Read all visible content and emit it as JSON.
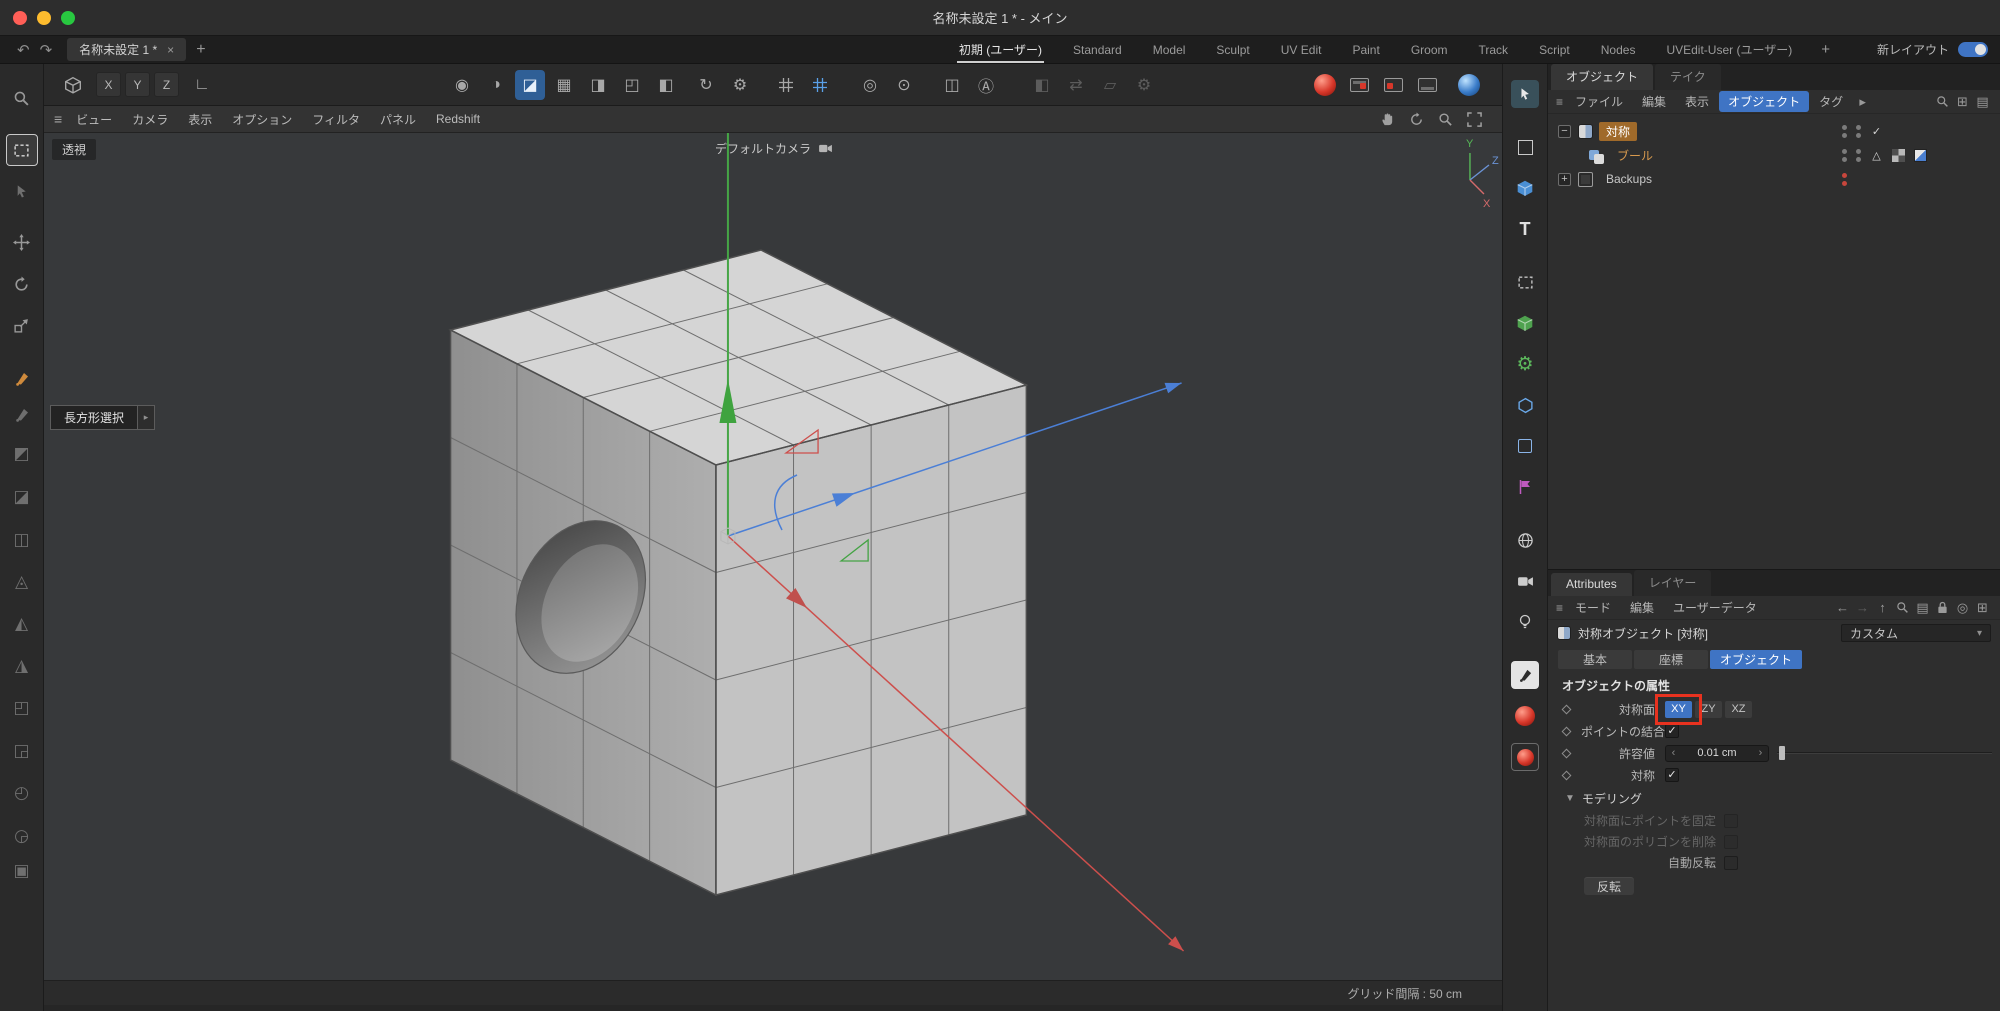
{
  "window": {
    "title": "名称未設定 1 * - メイン"
  },
  "tabbar": {
    "document_tab": "名称未設定 1 *",
    "layout_tabs": [
      "初期 (ユーザー)",
      "Standard",
      "Model",
      "Sculpt",
      "UV Edit",
      "Paint",
      "Groom",
      "Track",
      "Script",
      "Nodes",
      "UVEdit-User (ユーザー)"
    ],
    "active_layout_tab": "初期 (ユーザー)",
    "new_layout_label": "新レイアウト"
  },
  "toolbar": {
    "axis_lock": [
      "X",
      "Y",
      "Z"
    ]
  },
  "viewport": {
    "menu": [
      "ビュー",
      "カメラ",
      "表示",
      "オプション",
      "フィルタ",
      "パネル",
      "Redshift"
    ],
    "projection_label": "透視",
    "camera_label": "デフォルトカメラ",
    "tool_hint": "長方形選択",
    "grid_status": "グリッド間隔 : 50 cm",
    "axis_indicator": {
      "x": "X",
      "y": "Y",
      "z": "Z"
    }
  },
  "object_manager": {
    "tabs": [
      "オブジェクト",
      "テイク"
    ],
    "menu": [
      "ファイル",
      "編集",
      "表示",
      "オブジェクト",
      "タグ"
    ],
    "highlighted_menu_item": "オブジェクト",
    "objects": [
      {
        "name": "対称",
        "selected": true
      },
      {
        "name": "ブール",
        "child_of": "対称"
      },
      {
        "name": "Backups",
        "selected": false
      }
    ]
  },
  "attributes": {
    "tabs": [
      "Attributes",
      "レイヤー"
    ],
    "menu": [
      "モード",
      "編集",
      "ユーザーデータ"
    ],
    "object_title": "対称オブジェクト [対称]",
    "preset_value": "カスタム",
    "section_tabs": [
      "基本",
      "座標",
      "オブジェクト"
    ],
    "active_section_tab": "オブジェクト",
    "group_title": "オブジェクトの属性",
    "mirror_plane": {
      "label": "対称面",
      "options": [
        "XY",
        "ZY",
        "XZ"
      ],
      "selected": "XY"
    },
    "weld_points": {
      "label": "ポイントの結合",
      "checked": true
    },
    "tolerance": {
      "label": "許容値",
      "value": "0.01 cm"
    },
    "symmetric": {
      "label": "対称",
      "checked": true
    },
    "modeling": {
      "title": "モデリング",
      "rows": [
        {
          "label": "対称面にポイントを固定",
          "checked": false,
          "enabled": false
        },
        {
          "label": "対称面のポリゴンを削除",
          "checked": false,
          "enabled": false
        },
        {
          "label": "自動反転",
          "checked": false,
          "enabled": true
        }
      ],
      "flip_button": "反転"
    }
  },
  "colors": {
    "accent_blue": "#3f74c4",
    "selection_orange": "#a06a2a",
    "generator_text_orange": "#d89a4e",
    "annotation_red": "#e8321f",
    "axis_x_red": "#d05a55",
    "axis_y_green": "#46a546",
    "axis_z_blue": "#4b7fd6",
    "traffic_red": "#ff5f57",
    "traffic_yellow": "#febc2e",
    "traffic_green": "#28c840"
  }
}
